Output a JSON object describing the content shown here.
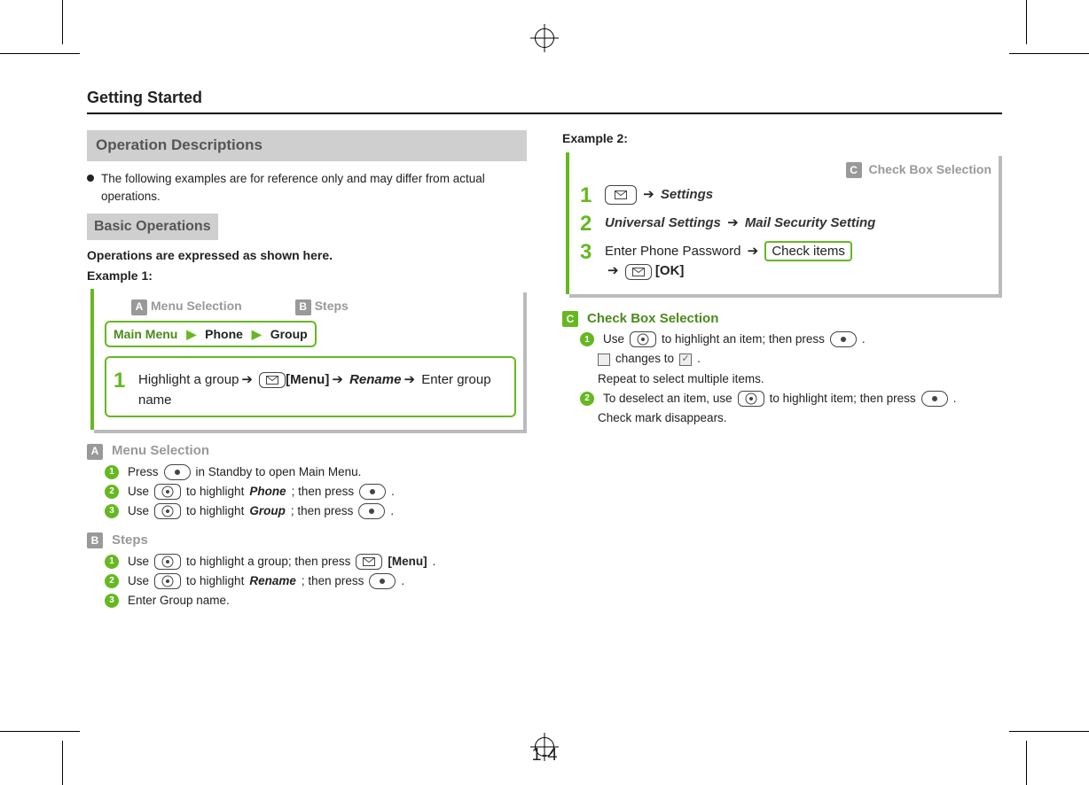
{
  "header": {
    "title": "Getting Started"
  },
  "page_number": "1-4",
  "left": {
    "section1_title": "Operation Descriptions",
    "section1_note": "The following examples are for reference only and may differ from actual operations.",
    "section2_title": "Basic Operations",
    "intro_line": "Operations are expressed as shown here.",
    "example1_label": "Example 1:",
    "badges": {
      "A": "A",
      "B": "B"
    },
    "callout_a": "Menu Selection",
    "callout_b": "Steps",
    "path": [
      "Main Menu",
      "Phone",
      "Group"
    ],
    "step1": {
      "num": "1",
      "t1": "Highlight a group",
      "menu": "[Menu]",
      "rename": "Rename",
      "t2": "Enter group name"
    },
    "A": {
      "i1": {
        "pre": "Press",
        "post": "in Standby to open Main Menu."
      },
      "i2": {
        "pre": "Use",
        "mid": "to highlight",
        "target": "Phone",
        "mid2": "; then press"
      },
      "i3": {
        "pre": "Use",
        "mid": "to highlight",
        "target": "Group",
        "mid2": "; then press"
      }
    },
    "B": {
      "i1": {
        "pre": "Use",
        "mid": "to highlight a group; then press",
        "menu": "[Menu]"
      },
      "i2": {
        "pre": "Use",
        "mid": "to highlight",
        "target": "Rename",
        "mid2": "; then press"
      },
      "i3": "Enter Group name."
    }
  },
  "right": {
    "example2_label": "Example 2:",
    "badges": {
      "C": "C"
    },
    "callout_c": "Check Box Selection",
    "s1": {
      "num": "1",
      "target": "Settings"
    },
    "s2": {
      "num": "2",
      "a": "Universal Settings",
      "b": "Mail Security Setting"
    },
    "s3": {
      "num": "3",
      "a": "Enter Phone Password",
      "check": "Check items",
      "ok": "[OK]"
    },
    "C": {
      "i1": {
        "pre": "Use",
        "mid": "to highlight an item; then press"
      },
      "i1b": {
        "mid": "changes to"
      },
      "i1c": "Repeat to select multiple items.",
      "i2": {
        "pre": "To deselect an item, use",
        "mid": "to highlight item; then press"
      },
      "i2b": "Check mark disappears."
    }
  }
}
